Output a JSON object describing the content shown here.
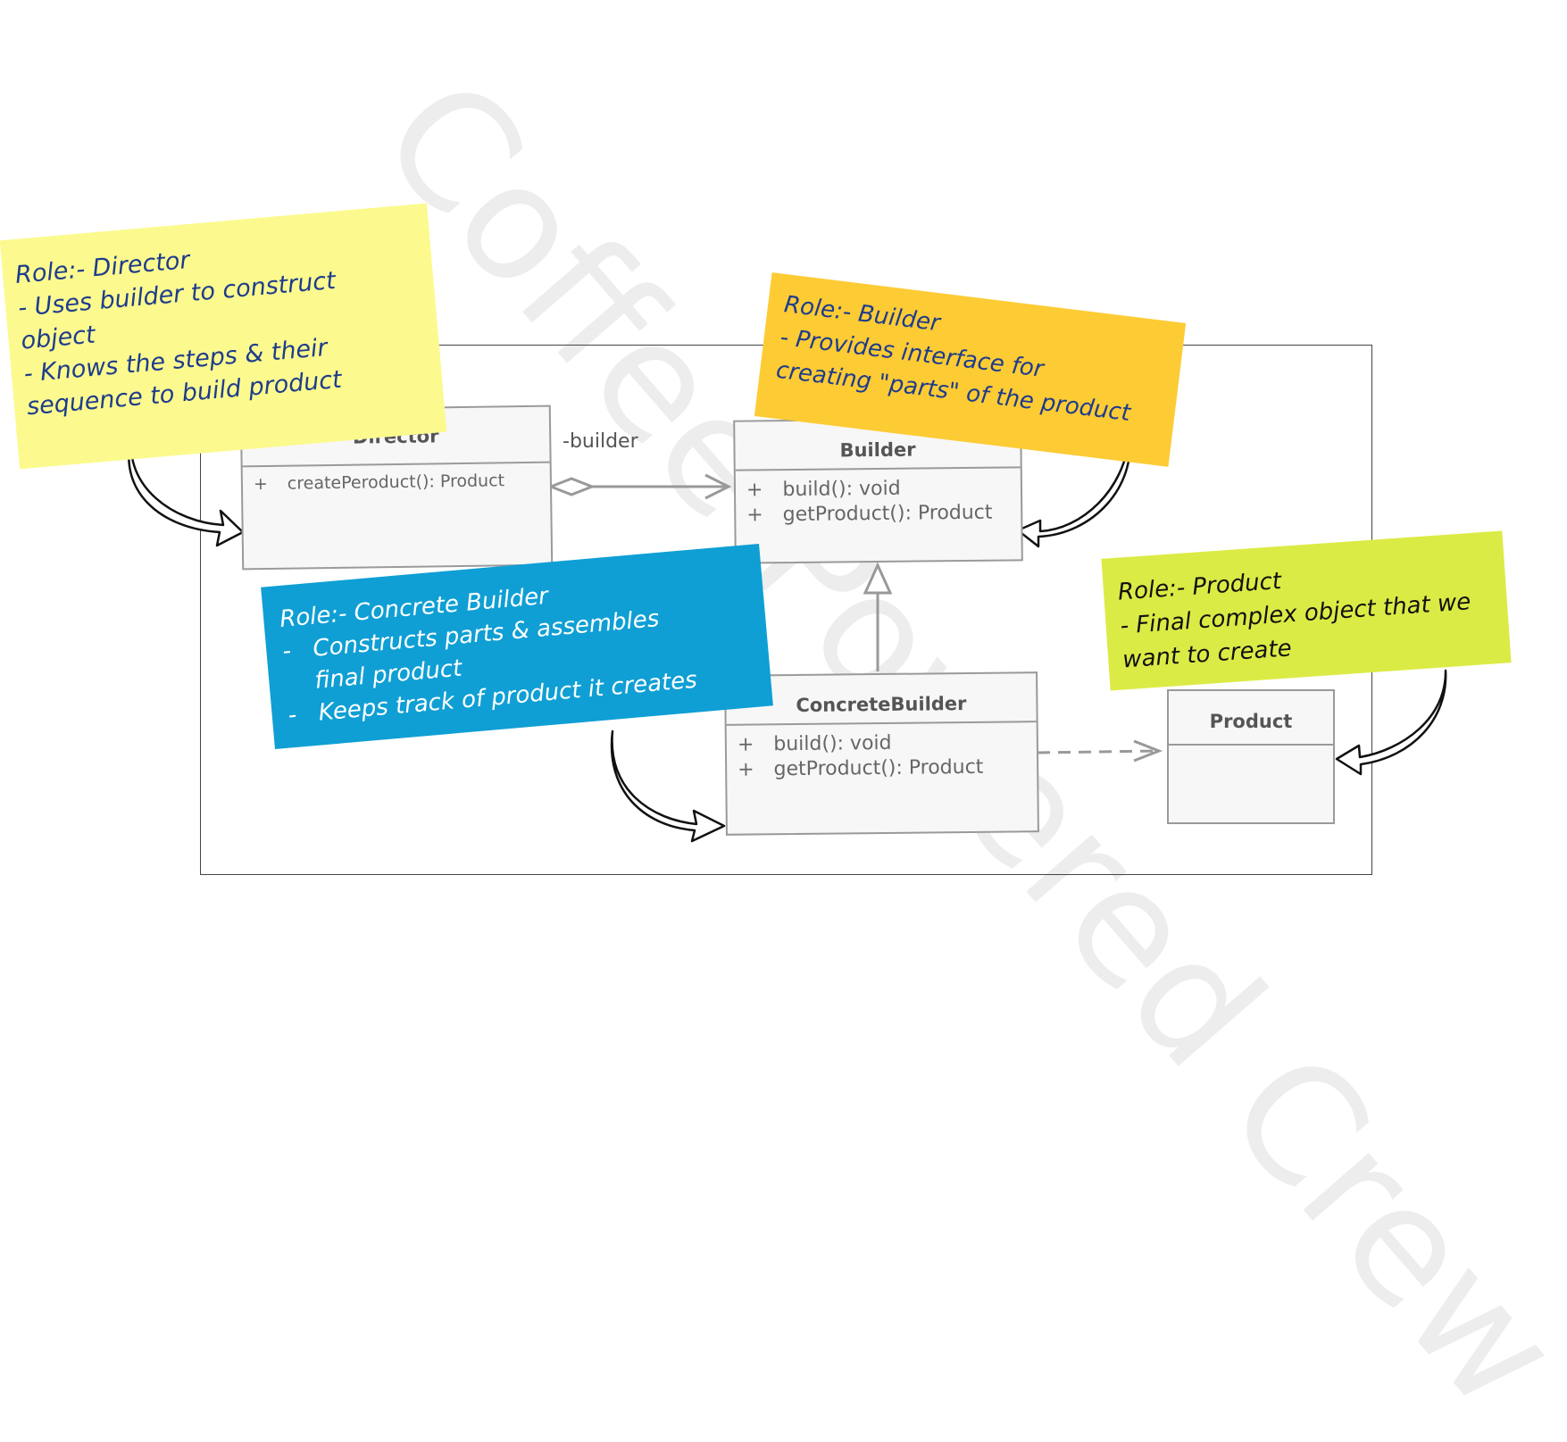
{
  "watermark": "Coffee Powered Crew",
  "classes": {
    "director": {
      "name": "Director",
      "ops": [
        {
          "vis": "+",
          "sig": "createPeroduct(): Product"
        }
      ]
    },
    "builder": {
      "name": "Builder",
      "ops": [
        {
          "vis": "+",
          "sig": "build(): void"
        },
        {
          "vis": "+",
          "sig": "getProduct(): Product"
        }
      ]
    },
    "concrete_builder": {
      "name": "ConcreteBuilder",
      "ops": [
        {
          "vis": "+",
          "sig": "build(): void"
        },
        {
          "vis": "+",
          "sig": "getProduct(): Product"
        }
      ]
    },
    "product": {
      "name": "Product"
    }
  },
  "association_label": "-builder",
  "notes": {
    "director": {
      "title": "Role:- Director",
      "lines": [
        "- Uses builder to construct",
        "object",
        "- Knows the steps & their",
        "sequence to build product"
      ]
    },
    "builder": {
      "title": "Role:- Builder",
      "lines": [
        "- Provides interface for",
        "creating \"parts\" of the product"
      ]
    },
    "concrete_builder": {
      "title": "Role:- Concrete Builder",
      "lines": [
        "-   Constructs parts & assembles",
        "    final product",
        "-   Keeps track of product it creates"
      ]
    },
    "product": {
      "title": "Role:- Product",
      "lines": [
        "- Final complex object that we",
        "want to create"
      ]
    }
  },
  "colors": {
    "director_note": "#fcfa8e",
    "builder_note": "#fdcb34",
    "concrete_note": "#0f9fd4",
    "product_note": "#dbeb45",
    "note_text_dark": "#1e3c8c",
    "note_text_light": "#ffffff"
  }
}
